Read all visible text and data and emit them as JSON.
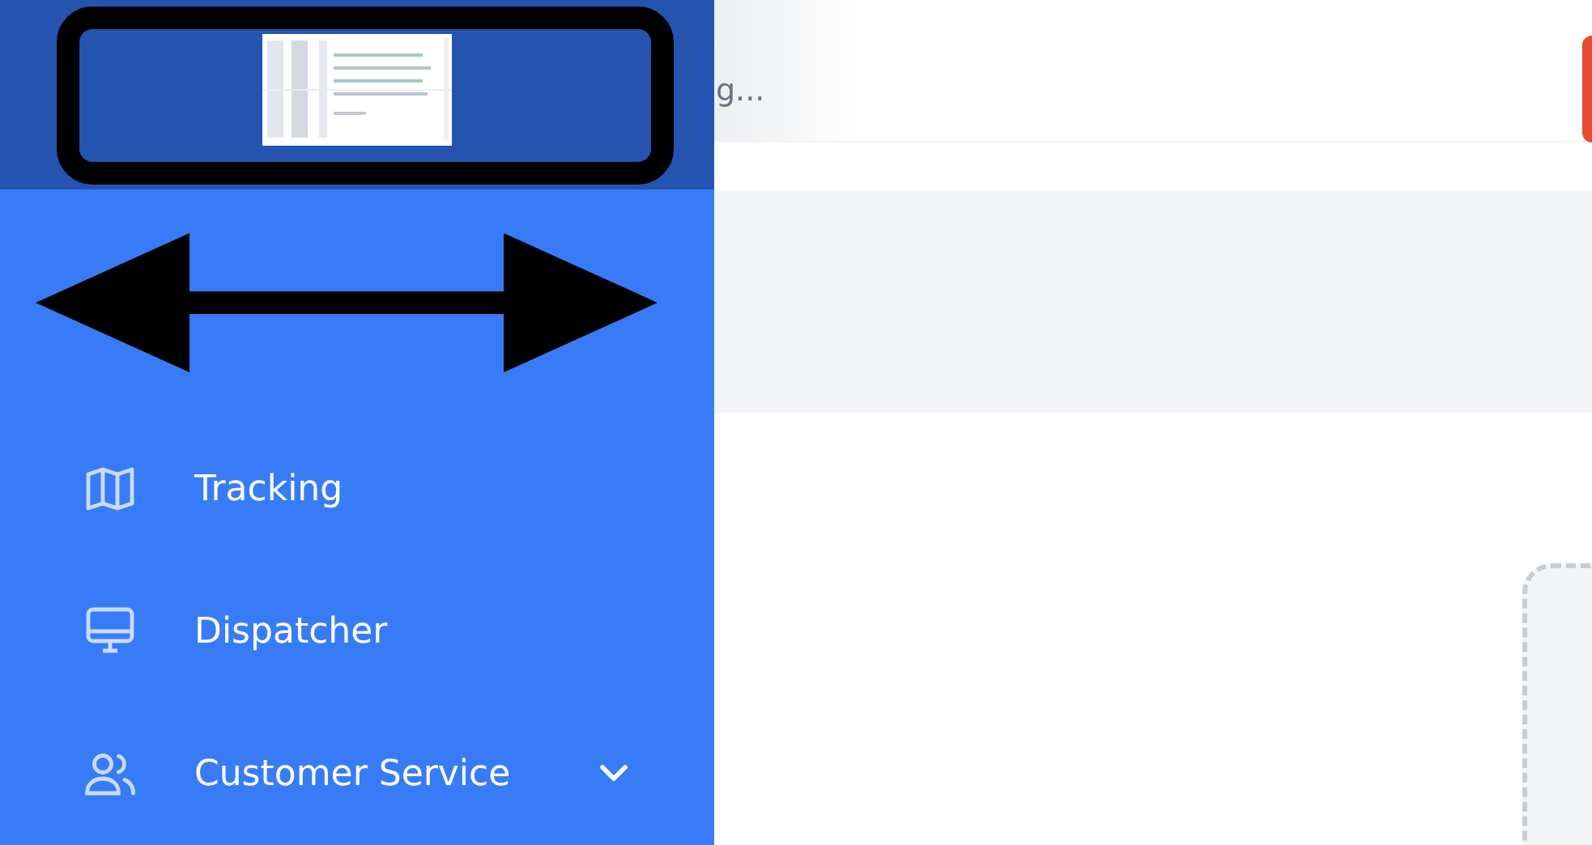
{
  "sidebar": {
    "nav_items": [
      {
        "label": "Tracking",
        "has_submenu": false
      },
      {
        "label": "Dispatcher",
        "has_submenu": false
      },
      {
        "label": "Customer Service",
        "has_submenu": true
      }
    ]
  },
  "header": {
    "text_1": "g..."
  }
}
